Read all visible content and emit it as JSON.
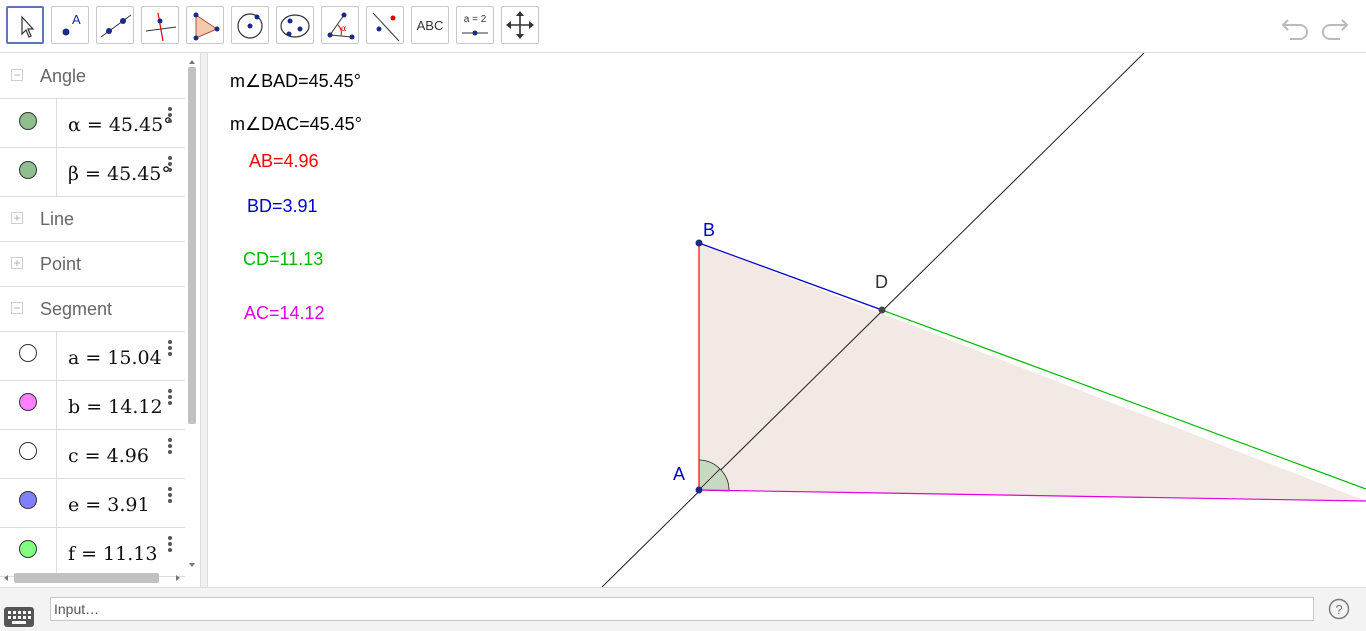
{
  "toolbar": {
    "tools": [
      {
        "name": "move-tool",
        "icon": "arrow-icon",
        "active": true
      },
      {
        "name": "point-tool",
        "icon": "point-icon",
        "label": "A"
      },
      {
        "name": "line-tool",
        "icon": "line-icon"
      },
      {
        "name": "perpendicular-tool",
        "icon": "perpendicular-icon"
      },
      {
        "name": "polygon-tool",
        "icon": "polygon-icon"
      },
      {
        "name": "circle-tool",
        "icon": "circle-icon"
      },
      {
        "name": "ellipse-tool",
        "icon": "ellipse-icon"
      },
      {
        "name": "angle-tool",
        "icon": "angle-icon"
      },
      {
        "name": "reflect-tool",
        "icon": "reflect-icon"
      },
      {
        "name": "text-tool",
        "icon": "text-icon",
        "label": "ABC"
      },
      {
        "name": "slider-tool",
        "icon": "slider-icon",
        "label": "a = 2"
      },
      {
        "name": "move-view-tool",
        "icon": "move-view-icon"
      }
    ],
    "undo_icon": "undo-icon",
    "redo_icon": "redo-icon"
  },
  "algebra": {
    "groups": [
      {
        "name": "Angle",
        "state": "−",
        "items": [
          {
            "text": "α = 45.45°",
            "color": "#8fbf8f",
            "border": "#333"
          },
          {
            "text": "β = 45.45°",
            "color": "#8fbf8f",
            "border": "#333"
          }
        ]
      },
      {
        "name": "Line",
        "state": "+",
        "items": []
      },
      {
        "name": "Point",
        "state": "+",
        "items": []
      },
      {
        "name": "Segment",
        "state": "−",
        "items": [
          {
            "text": "a = 15.04",
            "color": "#ffffff",
            "border": "#333"
          },
          {
            "text": "b = 14.12",
            "color": "#ff80ff",
            "border": "#333"
          },
          {
            "text": "c = 4.96",
            "color": "#ffffff",
            "border": "#333"
          },
          {
            "text": "e = 3.91",
            "color": "#8080ff",
            "border": "#333"
          },
          {
            "text": "f = 11.13",
            "color": "#80ff80",
            "border": "#333"
          }
        ]
      }
    ]
  },
  "graphics": {
    "texts": [
      {
        "text": "m∠BAD=45.45°",
        "color": "#000000"
      },
      {
        "text": "m∠DAC=45.45°",
        "color": "#000000"
      },
      {
        "text": "AB=4.96",
        "color": "#ff0000"
      },
      {
        "text": "BD=3.91",
        "color": "#0000cc"
      },
      {
        "text": "CD=11.13",
        "color": "#00bb00"
      },
      {
        "text": "AC=14.12",
        "color": "#e000e0"
      }
    ],
    "points": [
      {
        "label": "A",
        "color": "#0000cc"
      },
      {
        "label": "B",
        "color": "#0000cc"
      },
      {
        "label": "D",
        "color": "#333333"
      }
    ],
    "colors": {
      "triangle_fill": "#f2e8e4",
      "AB": "#ff0000",
      "BD": "#0000cc",
      "CD": "#00bb00",
      "AC": "#e000e0",
      "bisector": "#000000"
    }
  },
  "input": {
    "placeholder": "Input…",
    "keyboard_icon": "keyboard-icon",
    "help_icon": "help-icon"
  }
}
